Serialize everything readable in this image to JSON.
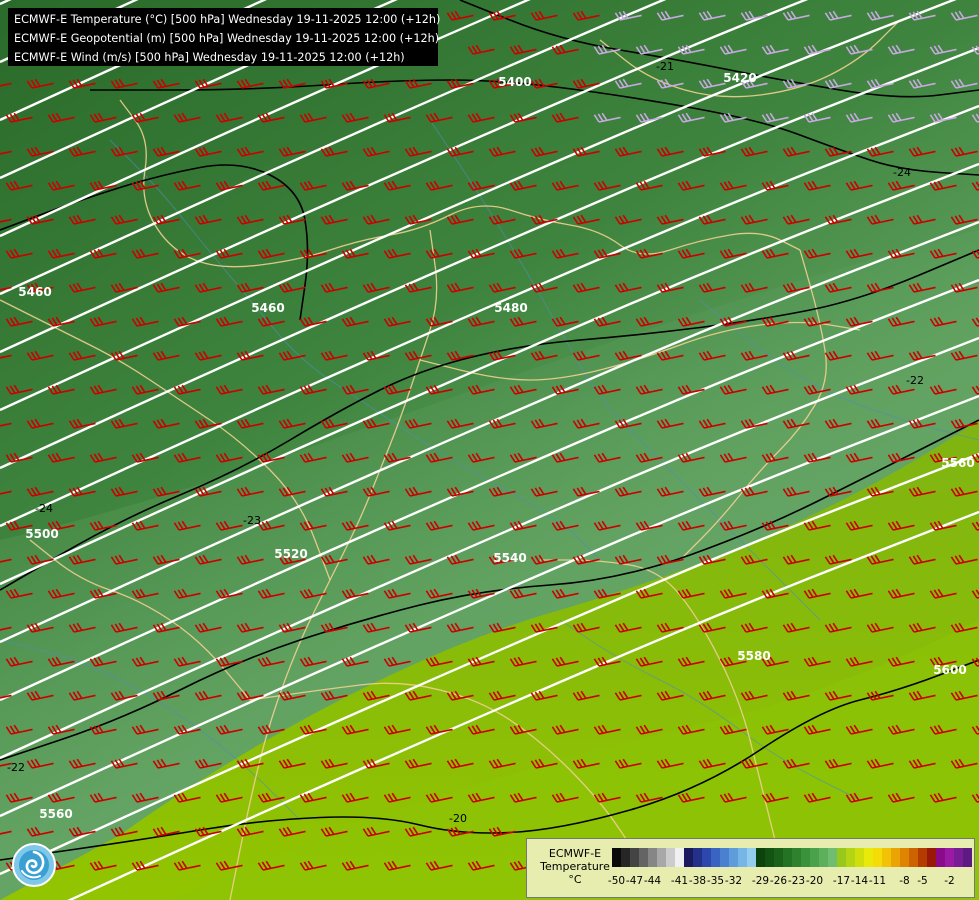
{
  "titles": [
    "ECMWF-E Temperature (°C) [500 hPa] Wednesday 19-11-2025 12:00 (+12h)",
    "ECMWF-E Geopotential (m) [500 hPa] Wednesday 19-11-2025 12:00 (+12h)",
    "ECMWF-E Wind (m/s) [500 hPa] Wednesday 19-11-2025 12:00 (+12h)"
  ],
  "geopotential_labels": [
    "5400",
    "5420",
    "5460",
    "5460",
    "5480",
    "5500",
    "5520",
    "5540",
    "5560",
    "5560",
    "5580",
    "5600"
  ],
  "temperature_labels": [
    "-21",
    "-24",
    "-24",
    "-23",
    "-22",
    "-22",
    "-20"
  ],
  "legend": {
    "model": "ECMWF-E",
    "variable": "Temperature",
    "unit": "°C",
    "ticks": [
      "-50",
      "-47",
      "-44",
      "-41",
      "-38",
      "-35",
      "-32",
      "-29",
      "-26",
      "-23",
      "-20",
      "-17",
      "-14",
      "-11",
      "-8",
      "-5",
      "-2"
    ],
    "colors": [
      "#0a0a0a",
      "#262626",
      "#444444",
      "#646464",
      "#868686",
      "#a8a8a8",
      "#cccccc",
      "#f0f0f0",
      "#1c1a5e",
      "#24308a",
      "#2c48ae",
      "#3a64c2",
      "#4a80cf",
      "#5e9cdc",
      "#76b6e6",
      "#94cdf0",
      "#0c420c",
      "#125212",
      "#1a621a",
      "#247224",
      "#2e822e",
      "#3a923a",
      "#4aa24a",
      "#5cb05c",
      "#70bc70",
      "#98c81c",
      "#b4d414",
      "#d0de0c",
      "#eaea0a",
      "#f5dc08",
      "#f2c206",
      "#eaa404",
      "#de8402",
      "#cc6200",
      "#b43c00",
      "#9a1808",
      "#8a0a8a",
      "#9a1aa6",
      "#7a1c96",
      "#5c1a82"
    ],
    "color_tick_indices": [
      0,
      2,
      4,
      7,
      9,
      11,
      13,
      16,
      18,
      20,
      22,
      25,
      27,
      29,
      32,
      34,
      37
    ]
  },
  "map_colors": {
    "cold_dark": "#2e6e2e",
    "mid_green": "#5c9e5c",
    "warm_lime": "#8cc000",
    "border": "#f0d090",
    "river": "#4f8fb8",
    "wind_barb": "#cc0000",
    "wind_barb_light": "#c8a8e0",
    "contour_z": "#ffffff",
    "contour_t": "#000000"
  },
  "logo_icon": "ecmwf-swirl-logo-icon"
}
